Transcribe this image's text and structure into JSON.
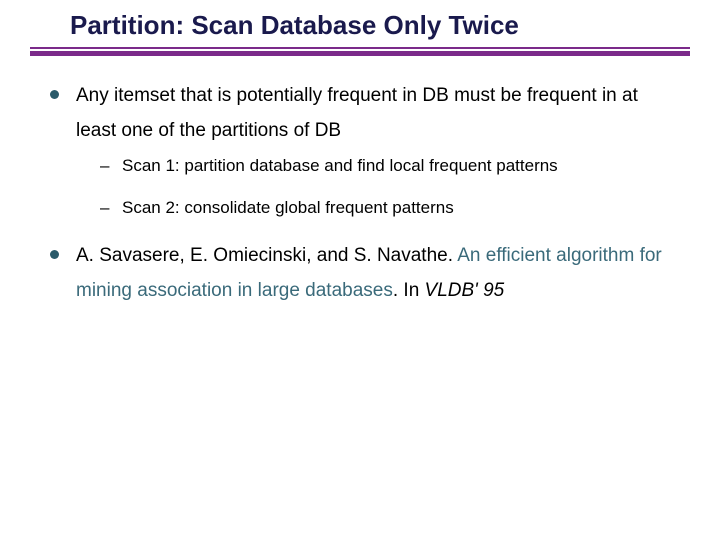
{
  "title": "Partition: Scan Database Only Twice",
  "bullets": {
    "item1": "Any itemset that is potentially frequent in DB must be frequent in at least one of the partitions of DB",
    "sub1": "Scan 1: partition database and find local frequent patterns",
    "sub2": "Scan 2: consolidate global frequent patterns",
    "item2_authors": "A. Savasere, E. Omiecinski, and S. Navathe. ",
    "item2_link": "An efficient algorithm for mining association in large databases",
    "item2_tail": ". In ",
    "item2_venue": "VLDB' 95"
  }
}
